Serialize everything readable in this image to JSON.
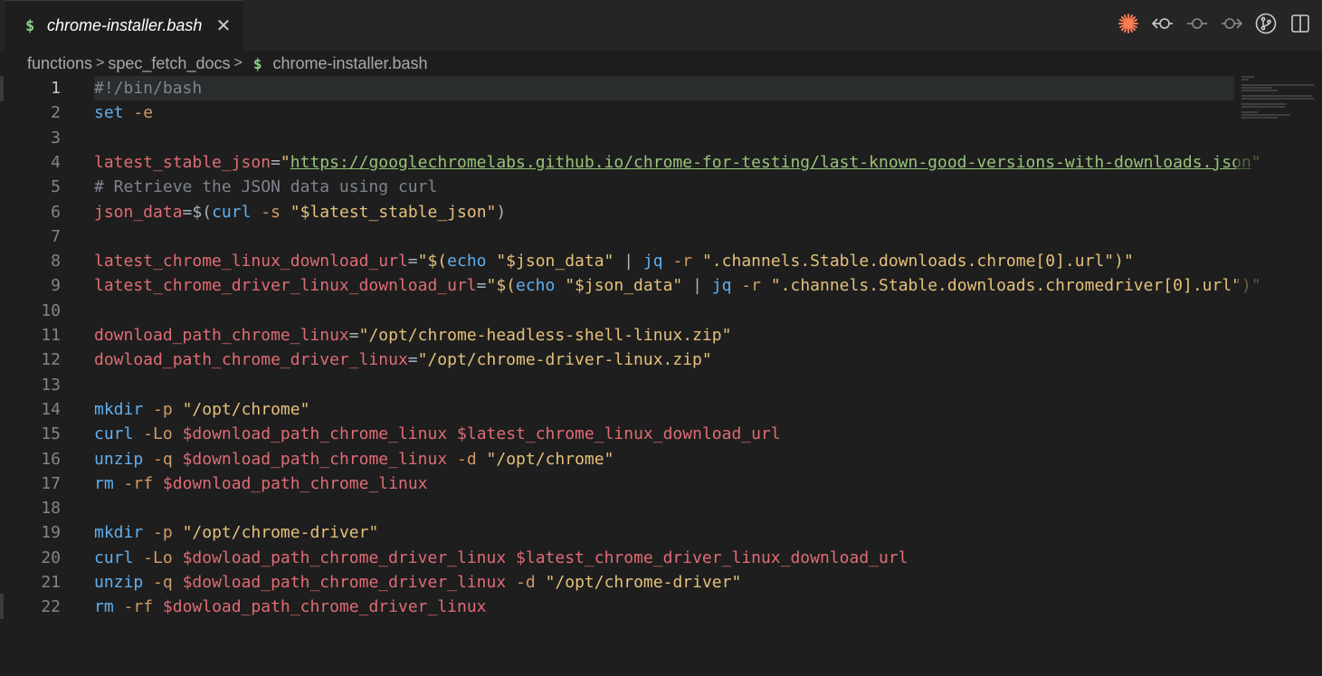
{
  "tab": {
    "icon_glyph": "$",
    "title": "chrome-installer.bash",
    "close_glyph": "✕"
  },
  "actions": [
    {
      "name": "copilot-icon"
    },
    {
      "name": "go-back-icon"
    },
    {
      "name": "timeline-icon"
    },
    {
      "name": "go-forward-icon"
    },
    {
      "name": "source-control-icon"
    },
    {
      "name": "split-editor-icon"
    }
  ],
  "breadcrumb": {
    "items": [
      "functions",
      "spec_fetch_docs"
    ],
    "file_icon": "$",
    "file": "chrome-installer.bash",
    "separator": ">"
  },
  "editor": {
    "active_line": 1,
    "lines": [
      {
        "n": "1",
        "tokens": [
          [
            "com",
            "#!/bin/bash"
          ]
        ]
      },
      {
        "n": "2",
        "tokens": [
          [
            "cmd",
            "set"
          ],
          [
            "op",
            " "
          ],
          [
            "flag",
            "-e"
          ]
        ]
      },
      {
        "n": "3",
        "tokens": []
      },
      {
        "n": "4",
        "tokens": [
          [
            "var",
            "latest_stable_json"
          ],
          [
            "op",
            "="
          ],
          [
            "str",
            "\""
          ],
          [
            "url",
            "https://googlechromelabs.github.io/chrome-for-testing/last-known-good-versions-with-downloads.json"
          ],
          [
            "str",
            "\""
          ]
        ]
      },
      {
        "n": "5",
        "tokens": [
          [
            "com",
            "# Retrieve the JSON data using curl"
          ]
        ]
      },
      {
        "n": "6",
        "tokens": [
          [
            "var",
            "json_data"
          ],
          [
            "op",
            "=$("
          ],
          [
            "cmd",
            "curl"
          ],
          [
            "op",
            " "
          ],
          [
            "flag",
            "-s"
          ],
          [
            "op",
            " "
          ],
          [
            "str",
            "\"$latest_stable_json\""
          ],
          [
            "op",
            ")"
          ]
        ]
      },
      {
        "n": "7",
        "tokens": []
      },
      {
        "n": "8",
        "tokens": [
          [
            "var",
            "latest_chrome_linux_download_url"
          ],
          [
            "op",
            "="
          ],
          [
            "str",
            "\"$("
          ],
          [
            "cmd",
            "echo"
          ],
          [
            "op",
            " "
          ],
          [
            "str",
            "\"$json_data\""
          ],
          [
            "op",
            " | "
          ],
          [
            "cmd",
            "jq"
          ],
          [
            "op",
            " "
          ],
          [
            "flag",
            "-r"
          ],
          [
            "op",
            " "
          ],
          [
            "str",
            "\".channels.Stable.downloads.chrome[0].url\")\""
          ]
        ]
      },
      {
        "n": "9",
        "tokens": [
          [
            "var",
            "latest_chrome_driver_linux_download_url"
          ],
          [
            "op",
            "="
          ],
          [
            "str",
            "\"$("
          ],
          [
            "cmd",
            "echo"
          ],
          [
            "op",
            " "
          ],
          [
            "str",
            "\"$json_data\""
          ],
          [
            "op",
            " | "
          ],
          [
            "cmd",
            "jq"
          ],
          [
            "op",
            " "
          ],
          [
            "flag",
            "-r"
          ],
          [
            "op",
            " "
          ],
          [
            "str",
            "\".channels.Stable.downloads.chromedriver[0].url\")\""
          ]
        ]
      },
      {
        "n": "10",
        "tokens": []
      },
      {
        "n": "11",
        "tokens": [
          [
            "var",
            "download_path_chrome_linux"
          ],
          [
            "op",
            "="
          ],
          [
            "str",
            "\"/opt/chrome-headless-shell-linux.zip\""
          ]
        ]
      },
      {
        "n": "12",
        "tokens": [
          [
            "var",
            "dowload_path_chrome_driver_linux"
          ],
          [
            "op",
            "="
          ],
          [
            "str",
            "\"/opt/chrome-driver-linux.zip\""
          ]
        ]
      },
      {
        "n": "13",
        "tokens": []
      },
      {
        "n": "14",
        "tokens": [
          [
            "cmd",
            "mkdir"
          ],
          [
            "op",
            " "
          ],
          [
            "flag",
            "-p"
          ],
          [
            "op",
            " "
          ],
          [
            "str",
            "\"/opt/chrome\""
          ]
        ]
      },
      {
        "n": "15",
        "tokens": [
          [
            "cmd",
            "curl"
          ],
          [
            "op",
            " "
          ],
          [
            "flag",
            "-Lo"
          ],
          [
            "op",
            " "
          ],
          [
            "var",
            "$download_path_chrome_linux"
          ],
          [
            "op",
            " "
          ],
          [
            "var",
            "$latest_chrome_linux_download_url"
          ]
        ]
      },
      {
        "n": "16",
        "tokens": [
          [
            "cmd",
            "unzip"
          ],
          [
            "op",
            " "
          ],
          [
            "flag",
            "-q"
          ],
          [
            "op",
            " "
          ],
          [
            "var",
            "$download_path_chrome_linux"
          ],
          [
            "op",
            " "
          ],
          [
            "flag",
            "-d"
          ],
          [
            "op",
            " "
          ],
          [
            "str",
            "\"/opt/chrome\""
          ]
        ]
      },
      {
        "n": "17",
        "tokens": [
          [
            "cmd",
            "rm"
          ],
          [
            "op",
            " "
          ],
          [
            "flag",
            "-rf"
          ],
          [
            "op",
            " "
          ],
          [
            "var",
            "$download_path_chrome_linux"
          ]
        ]
      },
      {
        "n": "18",
        "tokens": []
      },
      {
        "n": "19",
        "tokens": [
          [
            "cmd",
            "mkdir"
          ],
          [
            "op",
            " "
          ],
          [
            "flag",
            "-p"
          ],
          [
            "op",
            " "
          ],
          [
            "str",
            "\"/opt/chrome-driver\""
          ]
        ]
      },
      {
        "n": "20",
        "tokens": [
          [
            "cmd",
            "curl"
          ],
          [
            "op",
            " "
          ],
          [
            "flag",
            "-Lo"
          ],
          [
            "op",
            " "
          ],
          [
            "var",
            "$dowload_path_chrome_driver_linux"
          ],
          [
            "op",
            " "
          ],
          [
            "var",
            "$latest_chrome_driver_linux_download_url"
          ]
        ]
      },
      {
        "n": "21",
        "tokens": [
          [
            "cmd",
            "unzip"
          ],
          [
            "op",
            " "
          ],
          [
            "flag",
            "-q"
          ],
          [
            "op",
            " "
          ],
          [
            "var",
            "$dowload_path_chrome_driver_linux"
          ],
          [
            "op",
            " "
          ],
          [
            "flag",
            "-d"
          ],
          [
            "op",
            " "
          ],
          [
            "str",
            "\"/opt/chrome-driver\""
          ]
        ]
      },
      {
        "n": "22",
        "tokens": [
          [
            "cmd",
            "rm"
          ],
          [
            "op",
            " "
          ],
          [
            "flag",
            "-rf"
          ],
          [
            "op",
            " "
          ],
          [
            "var",
            "$dowload_path_chrome_driver_linux"
          ]
        ]
      }
    ]
  },
  "colors": {
    "background": "#1e1e1e",
    "variable": "#e06c75",
    "string": "#e5c07b",
    "command": "#61afef",
    "comment": "#7f848e",
    "flag": "#d19a66",
    "url": "#98c379",
    "bash_icon": "#89d185",
    "copilot": "#ff7b54"
  }
}
